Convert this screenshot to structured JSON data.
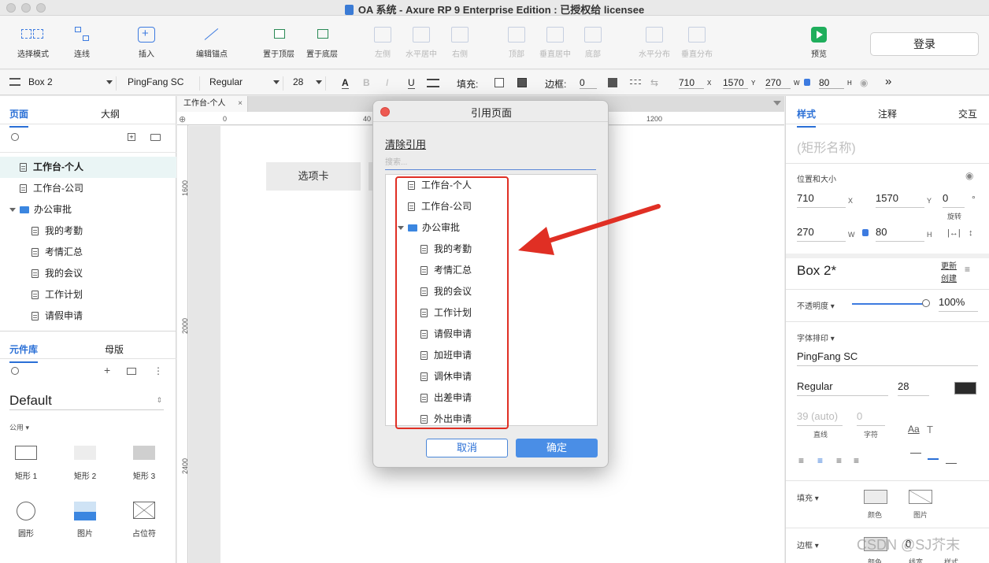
{
  "window": {
    "title": "OA 系统 - Axure RP 9 Enterprise Edition : 已授权给 licensee"
  },
  "toolbar": {
    "select_mode": "选择模式",
    "connect": "连线",
    "insert": "插入",
    "edit_anchor": "编辑锚点",
    "bring_front": "置于顶层",
    "send_back": "置于底层",
    "align_left": "左侧",
    "align_hcenter": "水平居中",
    "align_right": "右侧",
    "align_top": "顶部",
    "align_vcenter": "垂直居中",
    "align_bottom": "底部",
    "dist_h": "水平分布",
    "dist_v": "垂直分布",
    "preview": "预览",
    "login": "登录"
  },
  "formatbar": {
    "widget_name": "Box 2",
    "font_family": "PingFang SC",
    "font_style": "Regular",
    "font_size": "28",
    "fill_label": "填充:",
    "border_label": "边框:",
    "border_value": "0",
    "x": "710",
    "y": "1570",
    "w": "270",
    "h": "80",
    "x_unit": "X",
    "y_unit": "Y",
    "w_unit": "W",
    "h_unit": "H"
  },
  "left_panel": {
    "tabs": {
      "pages": "页面",
      "outline": "大纲"
    },
    "pages": [
      {
        "label": "工作台-个人"
      },
      {
        "label": "工作台-公司"
      },
      {
        "label": "办公审批"
      },
      {
        "label": "我的考勤"
      },
      {
        "label": "考情汇总"
      },
      {
        "label": "我的会议"
      },
      {
        "label": "工作计划"
      },
      {
        "label": "请假申请"
      }
    ],
    "lib_tabs": {
      "library": "元件库",
      "masters": "母版"
    },
    "library_name": "Default",
    "category": "公用",
    "widgets": [
      "矩形 1",
      "矩形 2",
      "矩形 3",
      "圆形",
      "图片",
      "占位符"
    ]
  },
  "canvas": {
    "doc_tab": "工作台-个人",
    "ruler_h": [
      "0",
      "40",
      "1200"
    ],
    "ruler_v": [
      "1600",
      "2000",
      "2400"
    ],
    "tab_widget_label": "选项卡"
  },
  "right_panel": {
    "tabs": {
      "style": "样式",
      "notes": "注释",
      "interact": "交互"
    },
    "shape_name_placeholder": "(矩形名称)",
    "pos_size_label": "位置和大小",
    "x": "710",
    "y": "1570",
    "rotation": "0",
    "rotation_unit": "°",
    "rotation_label": "旋转",
    "w": "270",
    "h": "80",
    "x_unit": "X",
    "y_unit": "Y",
    "w_unit": "W",
    "h_unit": "H",
    "style_name": "Box 2*",
    "update": "更新",
    "create": "创建",
    "opacity_label": "不透明度",
    "opacity_value": "100%",
    "typography_label": "字体排印",
    "font_family": "PingFang SC",
    "font_style": "Regular",
    "font_size": "28",
    "line_spacing": "39 (auto)",
    "char_spacing": "0",
    "line_label": "直线",
    "char_label": "字符",
    "fill_label": "填充",
    "fill_color": "颜色",
    "fill_image": "图片",
    "border_label": "边框",
    "border_color": "颜色",
    "border_width": "线宽",
    "border_style": "样式",
    "border_value": "0"
  },
  "modal": {
    "title": "引用页面",
    "clear": "清除引用",
    "search_placeholder": "搜索...",
    "items": [
      {
        "label": "工作台-个人",
        "type": "page"
      },
      {
        "label": "工作台-公司",
        "type": "page"
      },
      {
        "label": "办公审批",
        "type": "folder"
      },
      {
        "label": "我的考勤",
        "type": "page"
      },
      {
        "label": "考情汇总",
        "type": "page"
      },
      {
        "label": "我的会议",
        "type": "page"
      },
      {
        "label": "工作计划",
        "type": "page"
      },
      {
        "label": "请假申请",
        "type": "page"
      },
      {
        "label": "加班申请",
        "type": "page"
      },
      {
        "label": "调休申请",
        "type": "page"
      },
      {
        "label": "出差申请",
        "type": "page"
      },
      {
        "label": "外出申请",
        "type": "page"
      }
    ],
    "cancel": "取消",
    "ok": "确定"
  },
  "watermark": "CSDN @SJ芥末",
  "colors": {
    "accent": "#2a6fd6",
    "annotation_red": "#e02f24",
    "preview_green": "#1fae5c"
  }
}
